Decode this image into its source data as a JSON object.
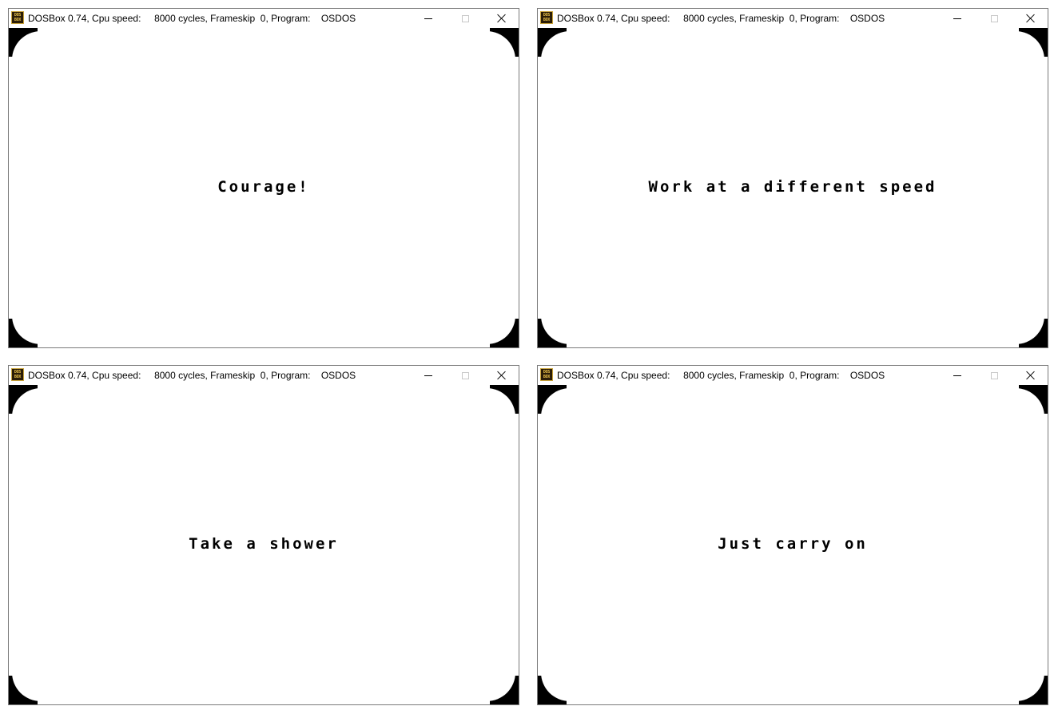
{
  "windows": [
    {
      "title": "DOSBox 0.74, Cpu speed:     8000 cycles, Frameskip  0, Program:    OSDOS",
      "icon": "dosbox-icon",
      "icon_text": [
        "DOS",
        "BOX"
      ],
      "message": "Courage!"
    },
    {
      "title": "DOSBox 0.74, Cpu speed:     8000 cycles, Frameskip  0, Program:    OSDOS",
      "icon": "dosbox-icon",
      "icon_text": [
        "DOS",
        "BOX"
      ],
      "message": "Work at a different speed"
    },
    {
      "title": "DOSBox 0.74, Cpu speed:     8000 cycles, Frameskip  0, Program:    OSDOS",
      "icon": "dosbox-icon",
      "icon_text": [
        "DOS",
        "BOX"
      ],
      "message": "Take a shower"
    },
    {
      "title": "DOSBox 0.74, Cpu speed:     8000 cycles, Frameskip  0, Program:    OSDOS",
      "icon": "dosbox-icon",
      "icon_text": [
        "DOS",
        "BOX"
      ],
      "message": "Just carry on"
    }
  ],
  "controls": {
    "minimize": "minimize-icon",
    "maximize": "maximize-icon",
    "close": "close-icon"
  },
  "colors": {
    "screen_background": "#ffffff",
    "text": "#000000",
    "window_border": "#7a7a7a"
  }
}
